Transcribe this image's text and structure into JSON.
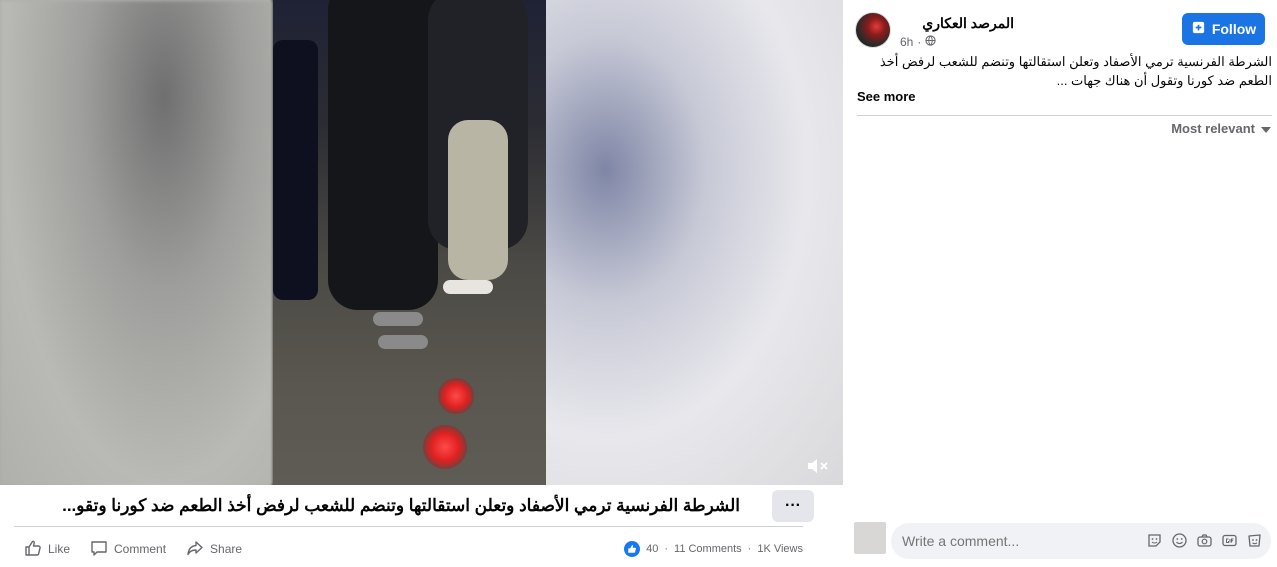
{
  "post": {
    "title": "الشرطة الفرنسية ترمي الأصفاد وتعلن استقالتها وتنضم للشعب لرفض أخذ الطعم ضد كورنا وتقو...",
    "more_label": "···"
  },
  "actions": {
    "like": "Like",
    "comment": "Comment",
    "share": "Share"
  },
  "stats": {
    "reactions": "40",
    "separator": "·",
    "comments": "11 Comments",
    "views": "1K Views"
  },
  "panel": {
    "author": "المرصد العكاري",
    "time": "6h",
    "time_dot": "·",
    "follow_label": "Follow",
    "text": "الشرطة الفرنسية ترمي الأصفاد وتعلن استقالتها وتنضم للشعب لرفض أخذ الطعم ضد كورنا وتقول أن هناك جهات ...",
    "see_more": "See more",
    "sort_label": "Most relevant"
  },
  "comment": {
    "placeholder": "Write a comment..."
  },
  "icons": {
    "video_mute": "speaker-muted-icon",
    "globe": "globe-icon",
    "follow": "follow-icon",
    "sort": "caret-down-icon",
    "comment_tools": [
      "sticker-icon",
      "emoji-icon",
      "camera-icon",
      "gif-icon",
      "sticker2-icon"
    ]
  },
  "colors": {
    "accent": "#1b74e4",
    "like_badge": "#1877f2",
    "muted_text": "#65676b"
  }
}
